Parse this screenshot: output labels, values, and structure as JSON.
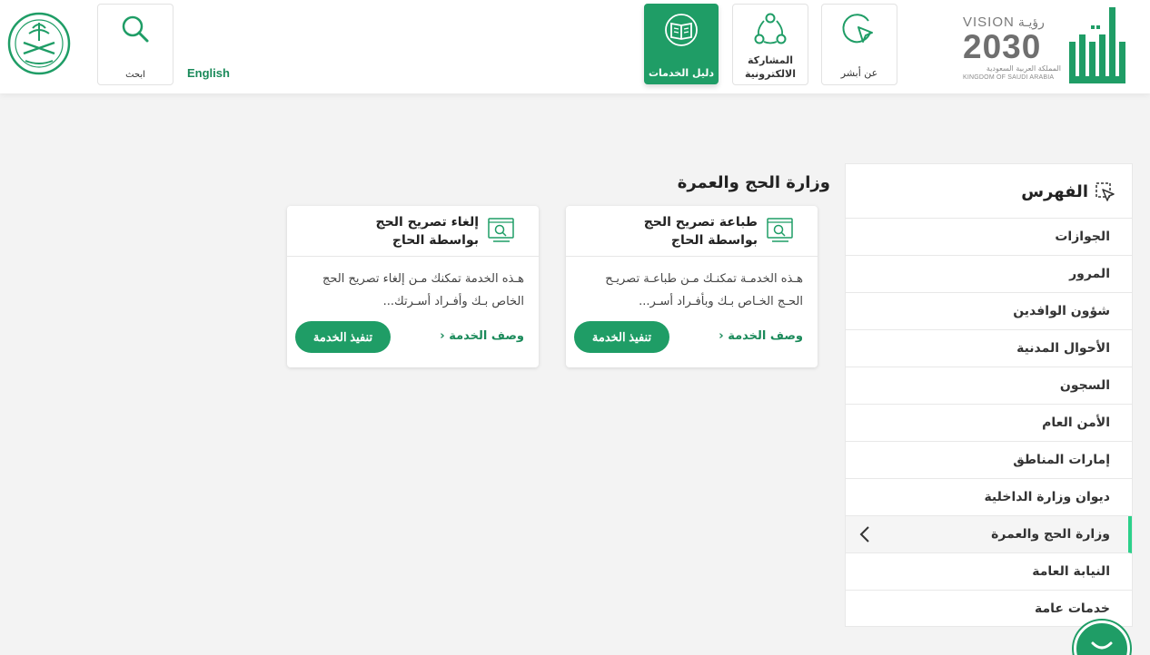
{
  "header": {
    "search_label": "ابحث",
    "language_link": "English",
    "nav": {
      "guide": "دليل الخدمات",
      "participation": "المشاركة الالكترونية",
      "about": "عن أبشر"
    },
    "vision": {
      "title_en": "VISION",
      "title_ar": "رؤيـة",
      "year": "2030",
      "kingdom_ar": "المملكة العربية السعودية",
      "kingdom_en": "KINGDOM OF SAUDI ARABIA"
    }
  },
  "sidebar": {
    "title": "الفهرس",
    "items": [
      {
        "label": "الجوازات"
      },
      {
        "label": "المرور"
      },
      {
        "label": "شؤون الوافدين"
      },
      {
        "label": "الأحوال المدنية"
      },
      {
        "label": "السجون"
      },
      {
        "label": "الأمن العام"
      },
      {
        "label": "إمارات المناطق"
      },
      {
        "label": "ديوان وزارة الداخلية"
      },
      {
        "label": "وزارة الحج والعمرة"
      },
      {
        "label": "النيابة العامة"
      },
      {
        "label": "خدمات عامة"
      }
    ],
    "active_item": "وزارة الحج والعمرة"
  },
  "main": {
    "section_title": "وزارة الحج والعمرة",
    "cards": [
      {
        "title": "طباعة تصريح الحج بواسطة الحاج",
        "description": "هـذه الخدمـة تمكنـك مـن طباعـة تصريـح الحـج الخـاص بـك وبأفـراد أسـر...",
        "link": "وصف الخدمة",
        "button": "تنفيذ الخدمة"
      },
      {
        "title": "إلغاء تصريح الحج بواسطة الحاج",
        "description": "هـذه الخدمة تمكنك مـن إلغاء تصريح الحج الخاص بـك وأفـراد أسـرتك...",
        "link": "وصف الخدمة",
        "button": "تنفيذ الخدمة"
      }
    ]
  },
  "colors": {
    "primary": "#1f9d66",
    "active_indicator": "#2bd08a",
    "link": "#1a8a5a"
  }
}
